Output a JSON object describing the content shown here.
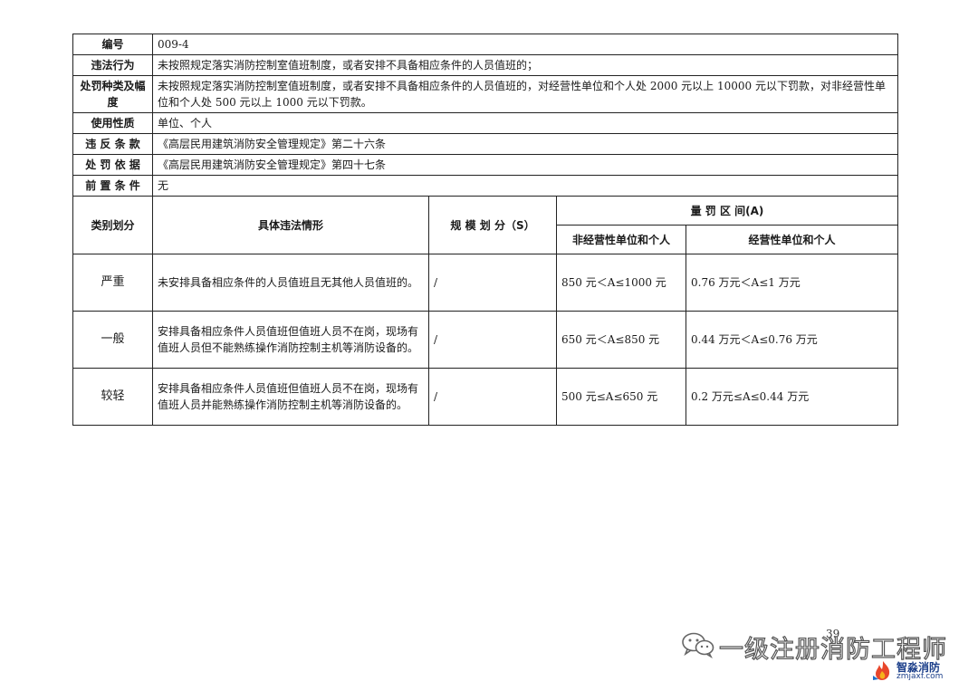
{
  "table": {
    "rows": [
      {
        "label": "编号",
        "value": "009-4"
      },
      {
        "label": "违法行为",
        "value": "未按照规定落实消防控制室值班制度，或者安排不具备相应条件的人员值班的；"
      },
      {
        "label": "处罚种类及幅度",
        "value": "未按照规定落实消防控制室值班制度，或者安排不具备相应条件的人员值班的，对经营性单位和个人处 2000 元以上 10000 元以下罚款，对非经营性单位和个人处 500 元以上 1000 元以下罚款。"
      },
      {
        "label": "使用性质",
        "value": "单位、个人"
      },
      {
        "label": "违 反 条 款",
        "value": "《高层民用建筑消防安全管理规定》第二十六条"
      },
      {
        "label": "处 罚 依 据",
        "value": "《高层民用建筑消防安全管理规定》第四十七条"
      },
      {
        "label": "前 置 条 件",
        "value": "无"
      }
    ],
    "headers": {
      "category": "类别划分",
      "situation": "具体违法情形",
      "scale": "规 模 划 分（S）",
      "range": "量 罚 区 间(A)",
      "non_commercial": "非经营性单位和个人",
      "commercial": "经营性单位和个人"
    },
    "data": [
      {
        "category": "严重",
        "situation": "未安排具备相应条件的人员值班且无其他人员值班的。",
        "scale": "/",
        "non_commercial": "850 元＜A≤1000 元",
        "commercial": "0.76 万元＜A≤1 万元"
      },
      {
        "category": "一般",
        "situation": "安排具备相应条件人员值班但值班人员不在岗，现场有值班人员但不能熟练操作消防控制主机等消防设备的。",
        "scale": "/",
        "non_commercial": "650 元＜A≤850 元",
        "commercial": "0.44 万元＜A≤0.76 万元"
      },
      {
        "category": "较轻",
        "situation": "安排具备相应条件人员值班但值班人员不在岗，现场有值班人员并能熟练操作消防控制主机等消防设备的。",
        "scale": "/",
        "non_commercial": "500 元≤A≤650 元",
        "commercial": "0.2 万元≤A≤0.44 万元"
      }
    ]
  },
  "page_number": "39",
  "watermark": {
    "text": "一级注册消防工程师",
    "icon": "wechat-icon"
  },
  "brand": {
    "name": "智淼消防",
    "url": "zmjaxf.com",
    "icon": "flame-logo-icon"
  }
}
